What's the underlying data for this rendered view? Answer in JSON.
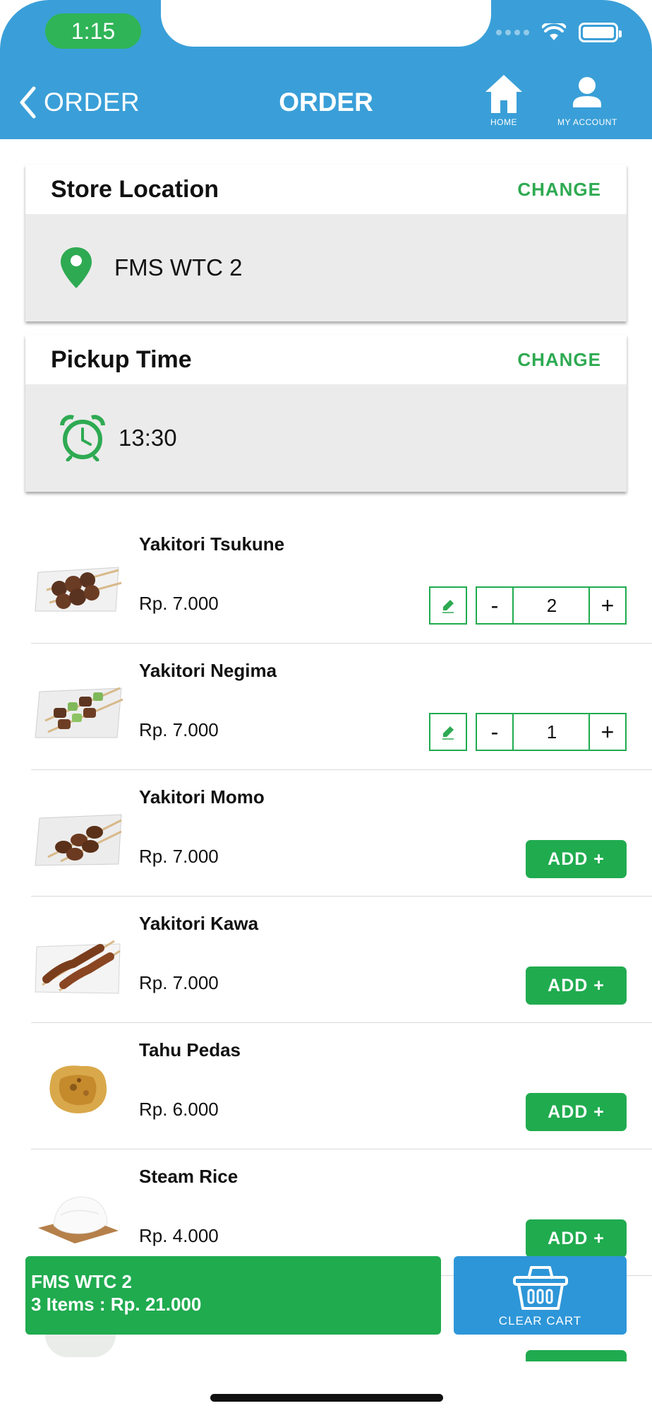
{
  "status_bar": {
    "time": "1:15"
  },
  "header": {
    "back_label": "ORDER",
    "title": "ORDER",
    "home_label": "HOME",
    "account_label": "MY ACCOUNT",
    "color": "#3a9fd8"
  },
  "store_location": {
    "title": "Store Location",
    "action": "CHANGE",
    "value": "FMS WTC 2",
    "icon": "map-pin-icon"
  },
  "pickup_time": {
    "title": "Pickup Time",
    "action": "CHANGE",
    "value": "13:30",
    "icon": "alarm-clock-icon"
  },
  "menu": {
    "items": [
      {
        "name": "Yakitori Tsukune",
        "price": "Rp. 7.000",
        "quantity": "2",
        "in_cart": true
      },
      {
        "name": "Yakitori Negima",
        "price": "Rp. 7.000",
        "quantity": "1",
        "in_cart": true
      },
      {
        "name": "Yakitori Momo",
        "price": "Rp. 7.000",
        "add_label": "ADD +",
        "in_cart": false
      },
      {
        "name": "Yakitori Kawa",
        "price": "Rp. 7.000",
        "add_label": "ADD +",
        "in_cart": false
      },
      {
        "name": "Tahu Pedas",
        "price": "Rp. 6.000",
        "add_label": "ADD +",
        "in_cart": false
      },
      {
        "name": "Steam Rice",
        "price": "Rp. 4.000",
        "add_label": "ADD +",
        "in_cart": false
      }
    ],
    "minus_label": "-",
    "plus_label": "+"
  },
  "cart": {
    "store": "FMS WTC 2",
    "summary": "3 Items : Rp. 21.000",
    "clear_label": "CLEAR CART"
  },
  "colors": {
    "accent_green": "#20ab4f",
    "header_blue": "#3a9fd8",
    "clear_blue": "#2d96d8"
  }
}
